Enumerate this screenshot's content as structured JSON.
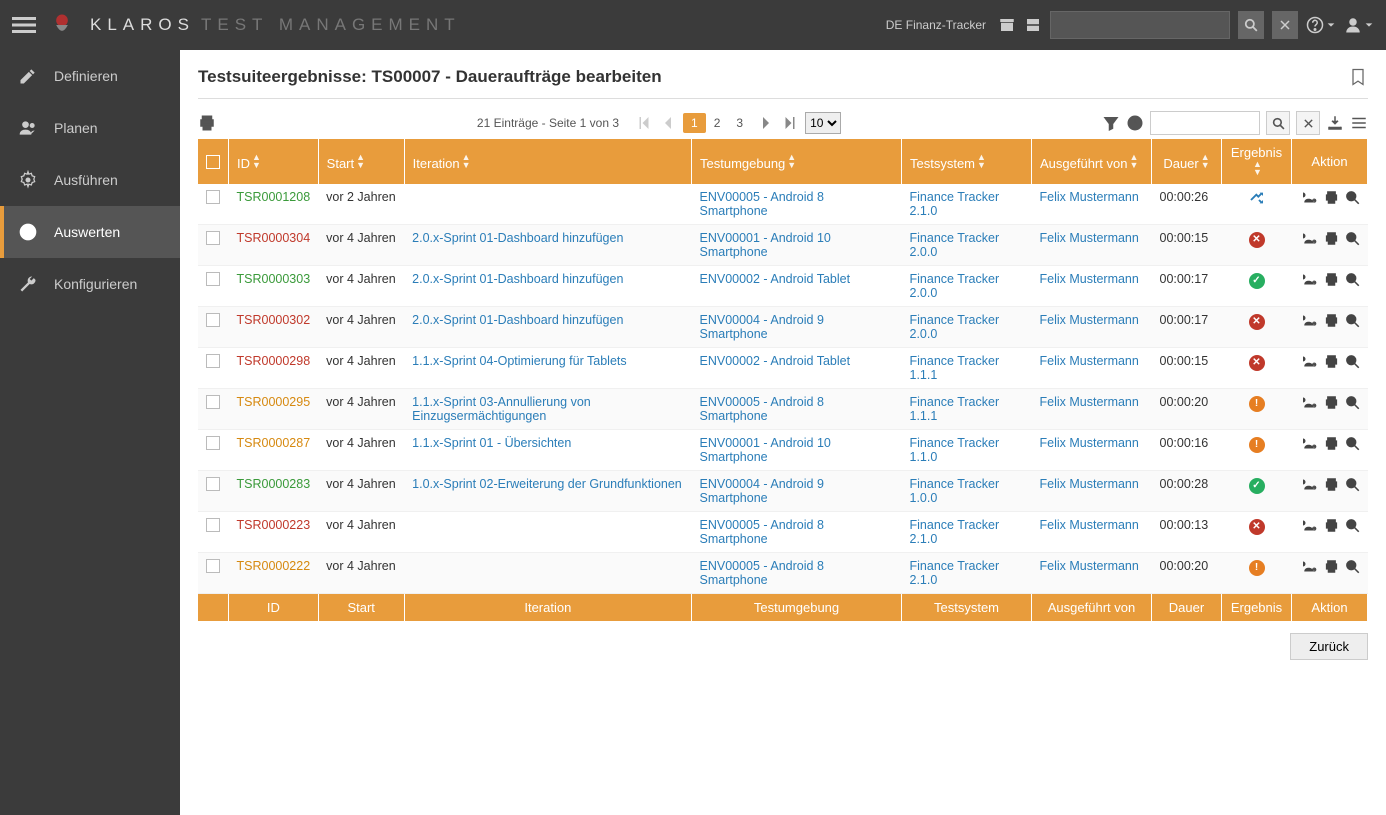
{
  "brand": {
    "main": "KLAROS",
    "sub": "TEST MANAGEMENT"
  },
  "project_name": "DE Finanz-Tracker",
  "sidebar": {
    "items": [
      {
        "label": "Definieren",
        "icon": "edit"
      },
      {
        "label": "Planen",
        "icon": "users"
      },
      {
        "label": "Ausführen",
        "icon": "gear"
      },
      {
        "label": "Auswerten",
        "icon": "chart",
        "active": true
      },
      {
        "label": "Konfigurieren",
        "icon": "wrench"
      }
    ]
  },
  "page_title": "Testsuiteergebnisse: TS00007 - Daueraufträge bearbeiten",
  "pager": {
    "info": "21 Einträge - Seite 1 von 3",
    "pages": [
      "1",
      "2",
      "3"
    ],
    "current": "1",
    "size": "10"
  },
  "columns": [
    "",
    "ID",
    "Start",
    "Iteration",
    "Testumgebung",
    "Testsystem",
    "Ausgeführt von",
    "Dauer",
    "Ergebnis",
    "Aktion"
  ],
  "footer_columns": [
    "",
    "ID",
    "Start",
    "Iteration",
    "Testumgebung",
    "Testsystem",
    "Ausgeführt von",
    "Dauer",
    "Ergebnis",
    "Aktion"
  ],
  "rows": [
    {
      "id": "TSR0001208",
      "id_cls": "id-pass",
      "start": "vor 2 Jahren",
      "iter": "",
      "env": "ENV00005 - Android 8 Smartphone",
      "sys": "Finance Tracker 2.1.0",
      "user": "Felix Mustermann",
      "dur": "00:00:26",
      "res": "shuffle"
    },
    {
      "id": "TSR0000304",
      "id_cls": "id-fail",
      "start": "vor 4 Jahren",
      "iter": "2.0.x-Sprint 01-Dashboard hinzufügen",
      "env": "ENV00001 - Android 10 Smartphone",
      "sys": "Finance Tracker 2.0.0",
      "user": "Felix Mustermann",
      "dur": "00:00:15",
      "res": "fail"
    },
    {
      "id": "TSR0000303",
      "id_cls": "id-pass",
      "start": "vor 4 Jahren",
      "iter": "2.0.x-Sprint 01-Dashboard hinzufügen",
      "env": "ENV00002 - Android Tablet",
      "sys": "Finance Tracker 2.0.0",
      "user": "Felix Mustermann",
      "dur": "00:00:17",
      "res": "pass"
    },
    {
      "id": "TSR0000302",
      "id_cls": "id-fail",
      "start": "vor 4 Jahren",
      "iter": "2.0.x-Sprint 01-Dashboard hinzufügen",
      "env": "ENV00004 - Android 9 Smartphone",
      "sys": "Finance Tracker 2.0.0",
      "user": "Felix Mustermann",
      "dur": "00:00:17",
      "res": "fail"
    },
    {
      "id": "TSR0000298",
      "id_cls": "id-fail",
      "start": "vor 4 Jahren",
      "iter": "1.1.x-Sprint 04-Optimierung für Tablets",
      "env": "ENV00002 - Android Tablet",
      "sys": "Finance Tracker 1.1.1",
      "user": "Felix Mustermann",
      "dur": "00:00:15",
      "res": "fail"
    },
    {
      "id": "TSR0000295",
      "id_cls": "id-warn",
      "start": "vor 4 Jahren",
      "iter": "1.1.x-Sprint 03-Annullierung von Einzugsermächtigungen",
      "env": "ENV00005 - Android 8 Smartphone",
      "sys": "Finance Tracker 1.1.1",
      "user": "Felix Mustermann",
      "dur": "00:00:20",
      "res": "warn"
    },
    {
      "id": "TSR0000287",
      "id_cls": "id-warn",
      "start": "vor 4 Jahren",
      "iter": "1.1.x-Sprint 01 - Übersichten",
      "env": "ENV00001 - Android 10 Smartphone",
      "sys": "Finance Tracker 1.1.0",
      "user": "Felix Mustermann",
      "dur": "00:00:16",
      "res": "warn"
    },
    {
      "id": "TSR0000283",
      "id_cls": "id-pass",
      "start": "vor 4 Jahren",
      "iter": "1.0.x-Sprint 02-Erweiterung der Grundfunktionen",
      "env": "ENV00004 - Android 9 Smartphone",
      "sys": "Finance Tracker 1.0.0",
      "user": "Felix Mustermann",
      "dur": "00:00:28",
      "res": "pass"
    },
    {
      "id": "TSR0000223",
      "id_cls": "id-fail",
      "start": "vor 4 Jahren",
      "iter": "",
      "env": "ENV00005 - Android 8 Smartphone",
      "sys": "Finance Tracker 2.1.0",
      "user": "Felix Mustermann",
      "dur": "00:00:13",
      "res": "fail"
    },
    {
      "id": "TSR0000222",
      "id_cls": "id-warn",
      "start": "vor 4 Jahren",
      "iter": "",
      "env": "ENV00005 - Android 8 Smartphone",
      "sys": "Finance Tracker 2.1.0",
      "user": "Felix Mustermann",
      "dur": "00:00:20",
      "res": "warn"
    }
  ],
  "back_label": "Zurück"
}
